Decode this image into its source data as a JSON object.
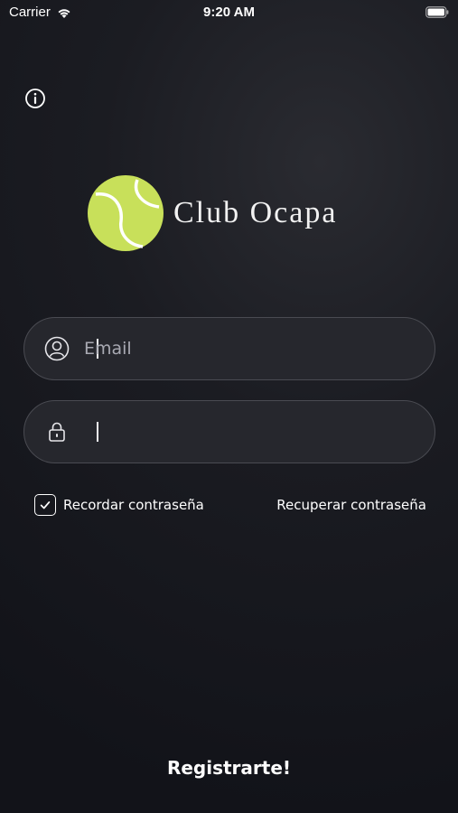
{
  "status_bar": {
    "carrier": "Carrier",
    "time": "9:20 AM"
  },
  "icons": {
    "info": "info-circle-icon",
    "user": "user-circle-icon",
    "lock": "lock-icon",
    "check": "checkmark-icon",
    "wifi": "wifi-icon",
    "battery": "battery-icon"
  },
  "brand": {
    "name": "Club Ocapa",
    "accent": "#c8e05a"
  },
  "login": {
    "email_placeholder": "Email",
    "email_value": "",
    "password_value": "",
    "remember_label": "Recordar contraseña",
    "remember_checked": true,
    "recover_label": "Recuperar contraseña",
    "register_label": "Registrarte!"
  }
}
